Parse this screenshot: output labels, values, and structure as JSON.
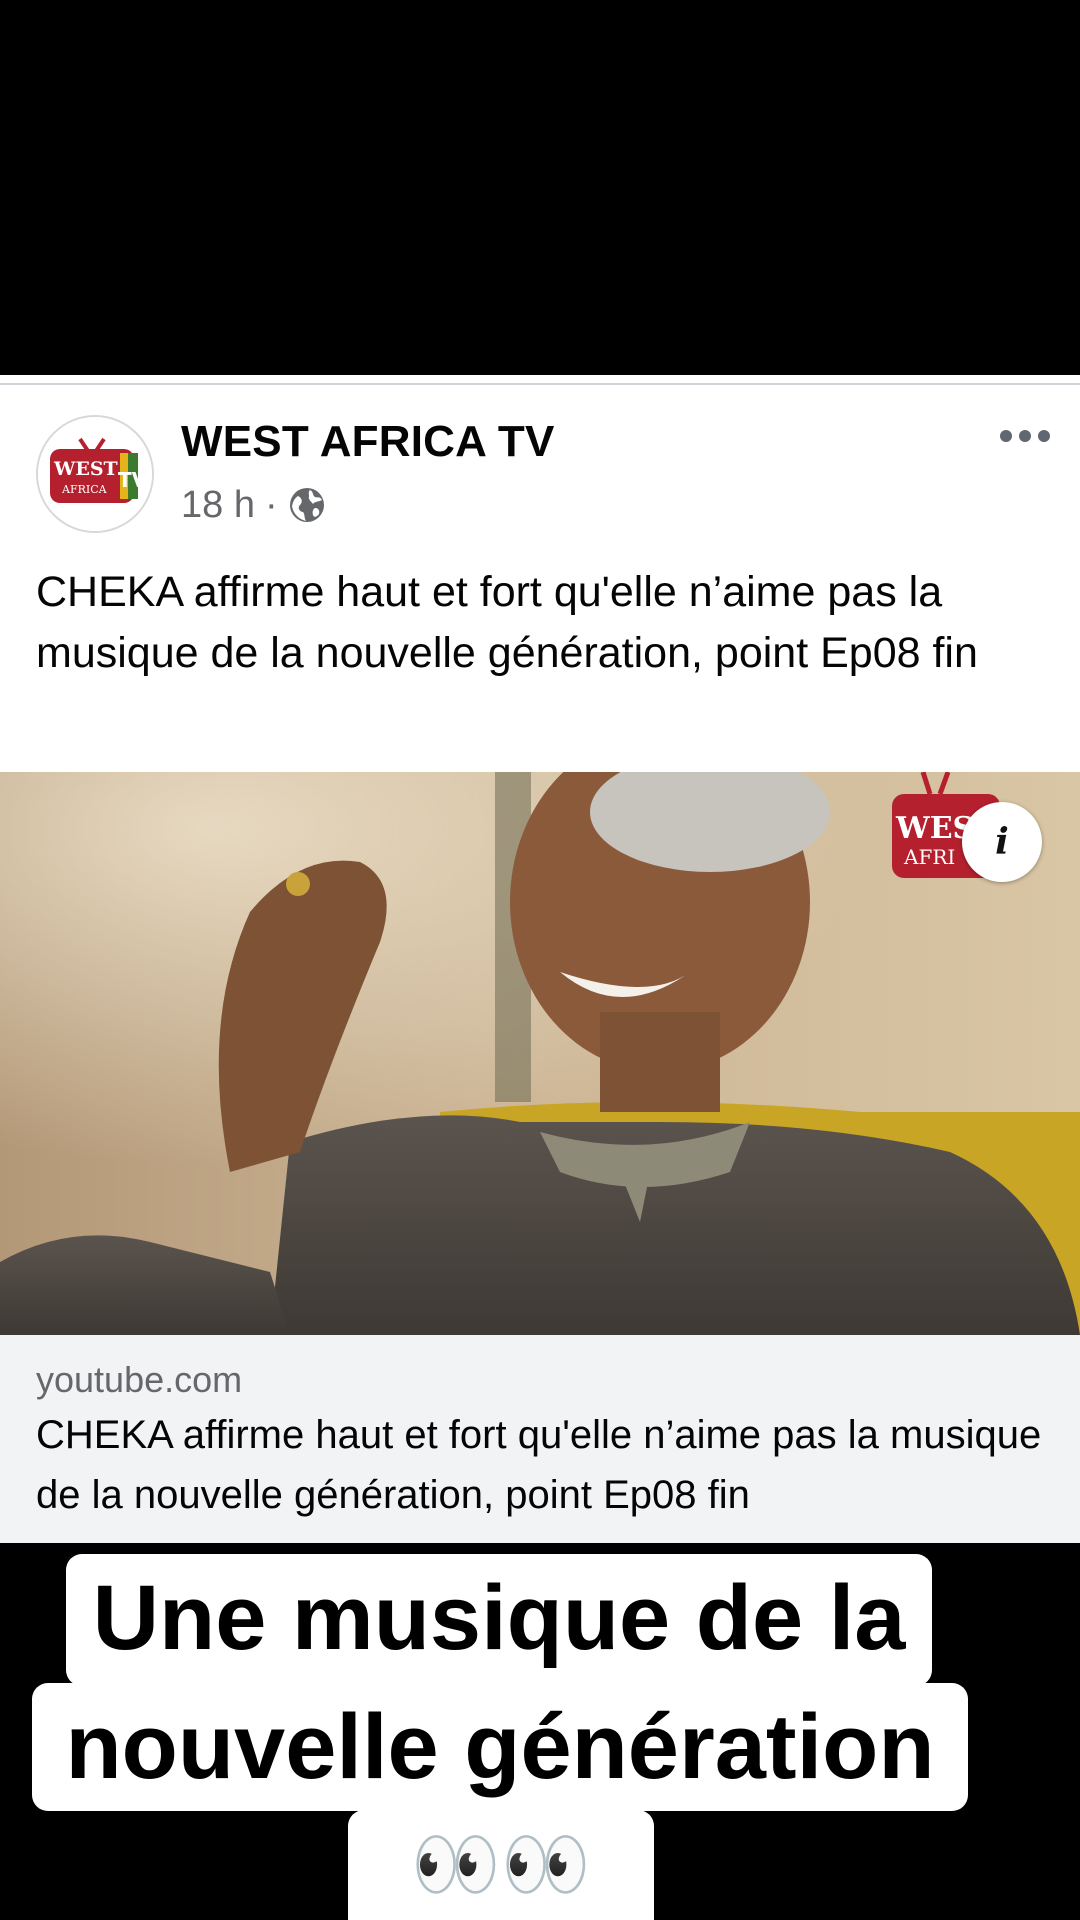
{
  "post": {
    "page_name": "WEST AFRICA TV",
    "time": "18 h",
    "dot": "·",
    "privacy_icon": "globe-icon",
    "more_icon": "more-dots-icon",
    "logo_text_top": "WEST",
    "logo_text_bottom": "AFRICA",
    "logo_tv": "TV",
    "caption": "CHEKA affirme haut et fort qu'elle n’aime pas la musique de la nouvelle génération, point Ep08 fin"
  },
  "thumbnail": {
    "info_label": "i",
    "watermark_top": "WEST",
    "watermark_bottom": "AFRI"
  },
  "link": {
    "domain": "youtube.com",
    "title": "CHEKA affirme haut et fort qu'elle n’aime pas la musique de la nouvelle génération, point Ep08 fin"
  },
  "overlay": {
    "line1": "Une musique de la",
    "line2": "nouvelle génération",
    "line3": "👀👀"
  },
  "colors": {
    "brand_red": "#b5202e",
    "brand_green": "#3c7a2e",
    "brand_yellow": "#e3b51a",
    "meta_grey": "#65676b"
  }
}
